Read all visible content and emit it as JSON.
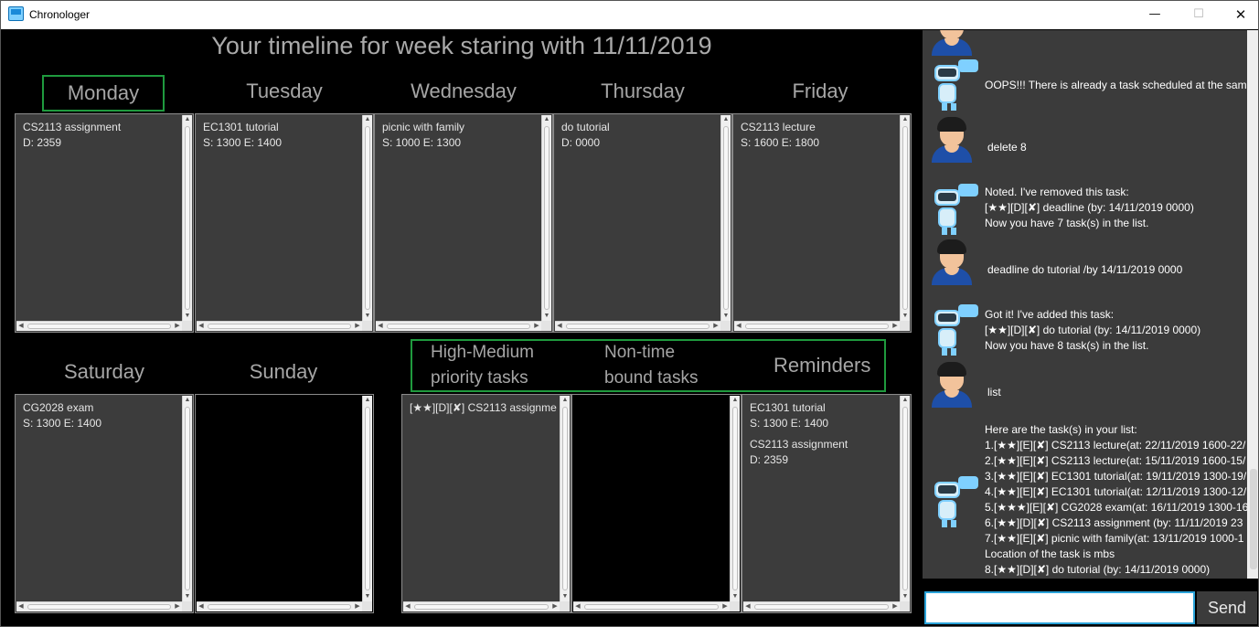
{
  "window": {
    "title": "Chronologer",
    "min_glyph": "—",
    "max_glyph": "☐",
    "close_glyph": "✕"
  },
  "timeline": {
    "title": "Your timeline for week staring with 11/11/2019",
    "days": [
      {
        "label": "Monday",
        "tasks": [
          {
            "name": "CS2113 assignment",
            "time": "D: 2359"
          }
        ]
      },
      {
        "label": "Tuesday",
        "tasks": [
          {
            "name": "EC1301 tutorial",
            "time": "S: 1300 E: 1400"
          }
        ]
      },
      {
        "label": "Wednesday",
        "tasks": [
          {
            "name": "picnic with family",
            "time": "S: 1000 E: 1300"
          }
        ]
      },
      {
        "label": "Thursday",
        "tasks": [
          {
            "name": "do tutorial",
            "time": "D: 0000"
          }
        ]
      },
      {
        "label": "Friday",
        "tasks": [
          {
            "name": "CS2113 lecture",
            "time": "S: 1600 E: 1800"
          }
        ]
      },
      {
        "label": "Saturday",
        "tasks": [
          {
            "name": "CG2028 exam",
            "time": "S: 1300 E: 1400"
          }
        ]
      },
      {
        "label": "Sunday",
        "tasks": []
      }
    ]
  },
  "sections": {
    "priority": {
      "line1": "High-Medium",
      "line2": "priority tasks",
      "items": [
        "[★★][D][✘] CS2113 assignme"
      ]
    },
    "nontime": {
      "line1": "Non-time",
      "line2": "bound tasks"
    },
    "reminders": {
      "label": "Reminders",
      "items": [
        {
          "name": "EC1301 tutorial",
          "time": "S: 1300 E: 1400"
        },
        {
          "name": "CS2113 assignment",
          "time": "D: 2359"
        }
      ]
    }
  },
  "chat": {
    "messages": [
      {
        "from": "bot",
        "lines": [
          "OOPS!!! There is already a task scheduled at the same"
        ]
      },
      {
        "from": "user",
        "lines": [
          "delete 8"
        ]
      },
      {
        "from": "bot",
        "lines": [
          "Noted. I've removed this task:",
          " [★★][D][✘] deadline (by: 14/11/2019 0000)",
          "Now you have 7 task(s) in the list."
        ]
      },
      {
        "from": "user",
        "lines": [
          "deadline do tutorial /by 14/11/2019 0000"
        ]
      },
      {
        "from": "bot",
        "lines": [
          "Got it! I've added this task:",
          "  [★★][D][✘] do tutorial (by: 14/11/2019 0000)",
          "Now you have 8 task(s) in the list."
        ]
      },
      {
        "from": "user",
        "lines": [
          "list"
        ]
      },
      {
        "from": "bot",
        "lines": [
          "Here are the task(s) in your list:",
          "1.[★★][E][✘] CS2113 lecture(at: 22/11/2019 1600-22/",
          "2.[★★][E][✘] CS2113 lecture(at: 15/11/2019 1600-15/",
          "3.[★★][E][✘] EC1301 tutorial(at: 19/11/2019 1300-19/",
          "4.[★★][E][✘] EC1301 tutorial(at: 12/11/2019 1300-12/",
          "5.[★★★][E][✘] CG2028 exam(at: 16/11/2019 1300-16",
          "6.[★★][D][✘] CS2113 assignment (by: 11/11/2019 23",
          "7.[★★][E][✘] picnic with family(at: 13/11/2019 1000-1",
          "Location of the task is mbs",
          "8.[★★][D][✘] do tutorial (by: 14/11/2019 0000)"
        ]
      }
    ],
    "input_value": "",
    "send_label": "Send"
  },
  "colors": {
    "accent_green": "#1f9a3e",
    "panel_bg": "#3c3c3c",
    "input_border": "#2aa3d9"
  }
}
